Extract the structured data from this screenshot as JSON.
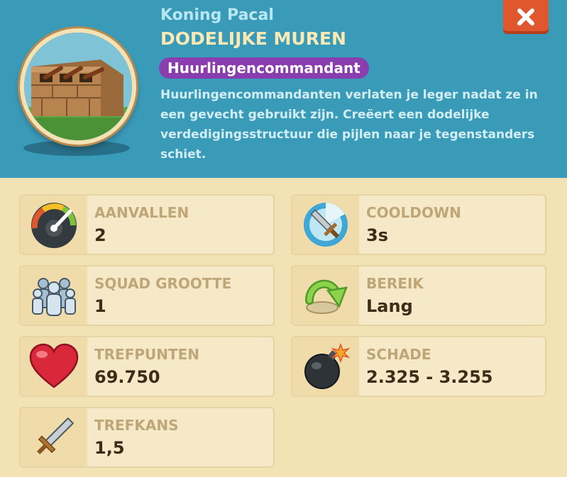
{
  "header": {
    "hero_name": "Koning Pacal",
    "title": "DODELIJKE MUREN",
    "badge": "Huurlingencommandant",
    "description": "Huurlingencommandanten verlaten je leger nadat ze in een gevecht gebruikt zijn. Creëert een dodelijke verdedigingsstructuur die pijlen naar je tegenstanders schiet.",
    "close_icon": "close-icon",
    "portrait_icon": "deadly-walls-icon"
  },
  "stats": [
    {
      "label": "AANVALLEN",
      "value": "2",
      "icon": "speedometer-icon"
    },
    {
      "label": "COOLDOWN",
      "value": "3s",
      "icon": "cooldown-sword-icon"
    },
    {
      "label": "SQUAD GROOTTE",
      "value": "1",
      "icon": "squad-icon"
    },
    {
      "label": "BEREIK",
      "value": "Lang",
      "icon": "range-arrow-icon"
    },
    {
      "label": "TREFPUNTEN",
      "value": "69.750",
      "icon": "heart-icon"
    },
    {
      "label": "SCHADE",
      "value": "2.325 - 3.255",
      "icon": "bomb-icon"
    },
    {
      "label": "TREFKANS",
      "value": "1,5",
      "icon": "sword-icon"
    }
  ],
  "colors": {
    "header_bg": "#3a9bb9",
    "panel_bg": "#f2e2b4",
    "badge_bg": "#8a3dae",
    "close_bg": "#e0572e"
  }
}
